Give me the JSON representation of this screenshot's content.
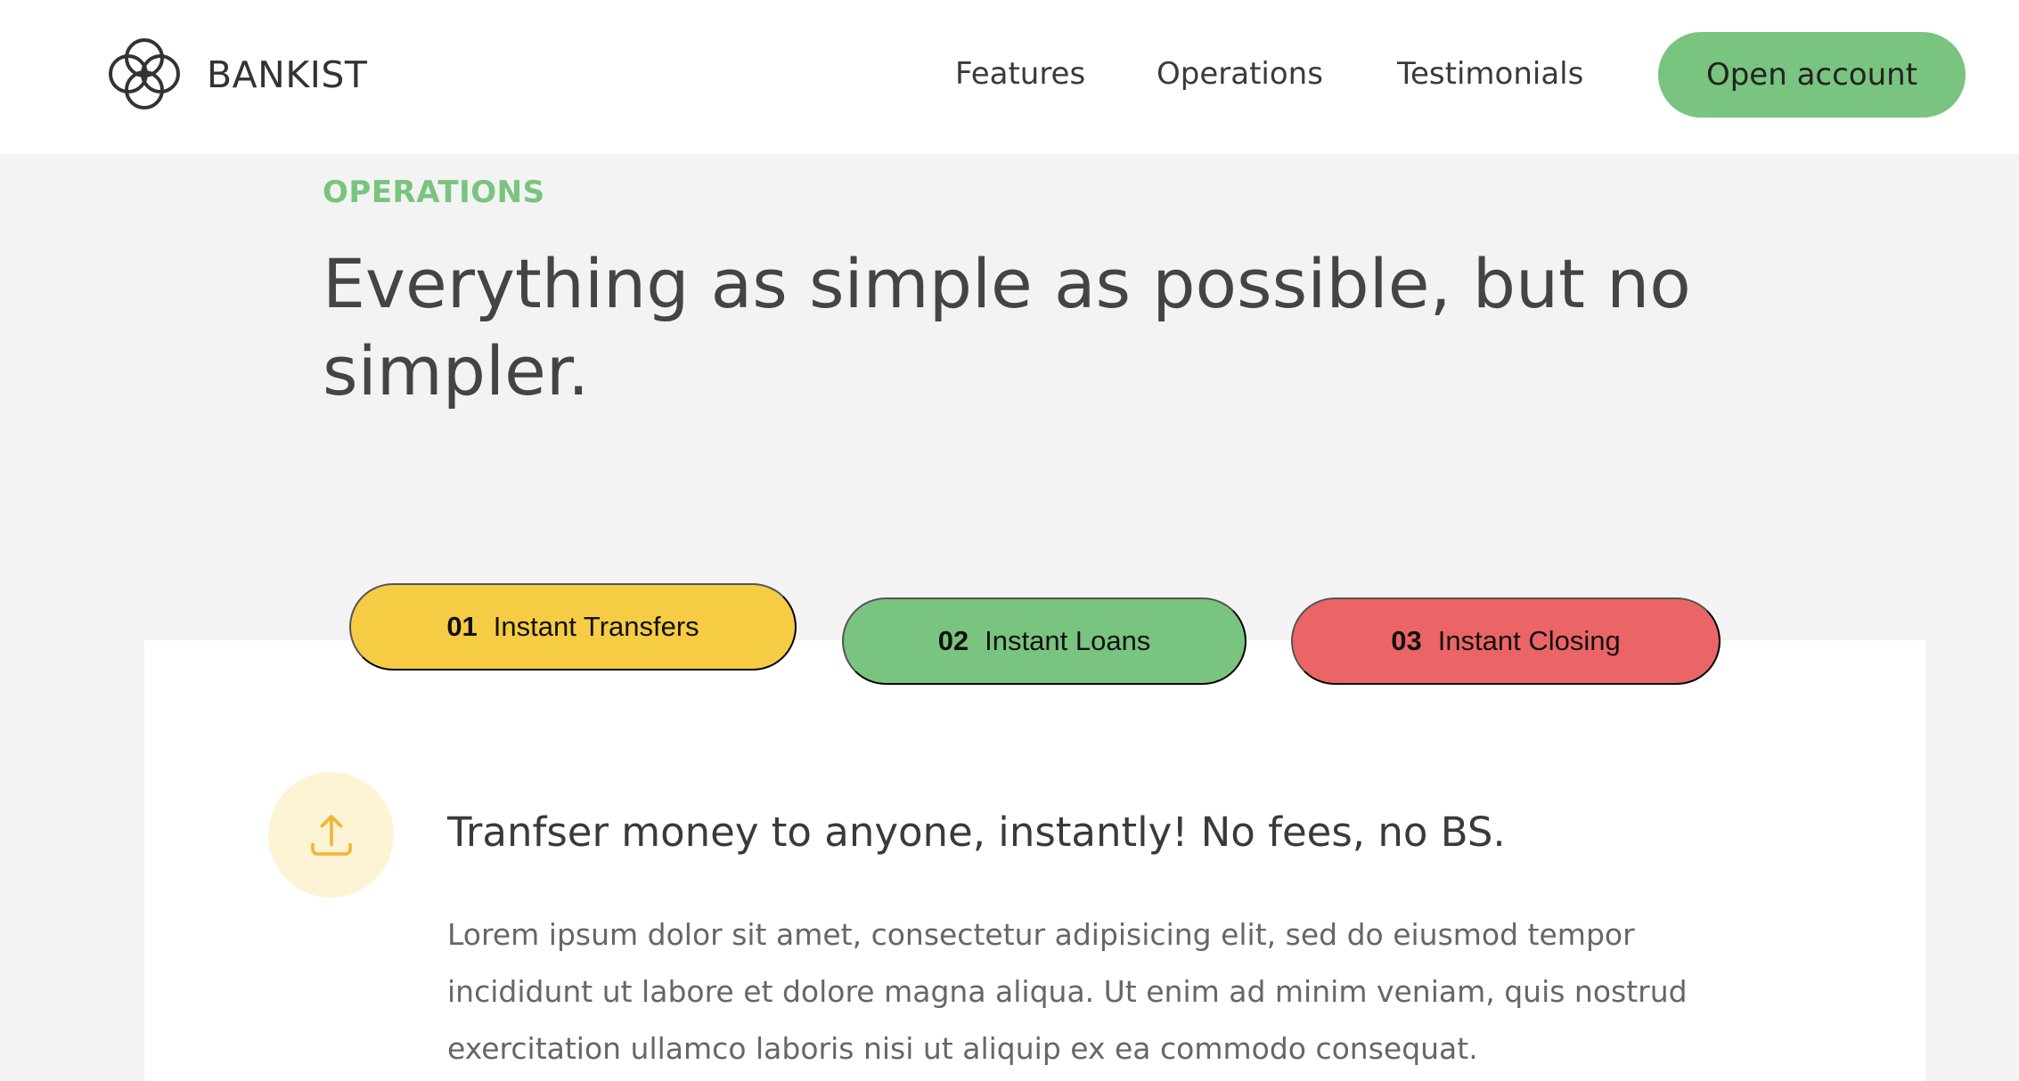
{
  "brand": {
    "name": "BANKIST",
    "icon": "interlocking-circles-logo"
  },
  "nav": {
    "links": [
      "Features",
      "Operations",
      "Testimonials"
    ],
    "cta_label": "Open account"
  },
  "section": {
    "label": "OPERATIONS",
    "title": "Everything as simple as possible, but no simpler."
  },
  "operations": {
    "tabs": [
      {
        "num": "01",
        "label": "Instant Transfers",
        "color": "#f6cc45",
        "active": true
      },
      {
        "num": "02",
        "label": "Instant Loans",
        "color": "#79c47f",
        "active": false
      },
      {
        "num": "03",
        "label": "Instant Closing",
        "color": "#eb6566",
        "active": false
      }
    ],
    "content": {
      "icon": "upload-icon",
      "heading": "Tranfser money to anyone, instantly! No fees, no BS.",
      "text": "Lorem ipsum dolor sit amet, consectetur adipisicing elit, sed do eiusmod tempor incididunt ut labore et dolore magna aliqua. Ut enim ad minim veniam, quis nostrud exercitation ullamco laboris nisi ut aliquip ex ea commodo consequat."
    }
  },
  "colors": {
    "accent_green": "#79c47f",
    "accent_yellow": "#f6cc45",
    "accent_red": "#eb6566",
    "background": "#f3f3f3"
  }
}
